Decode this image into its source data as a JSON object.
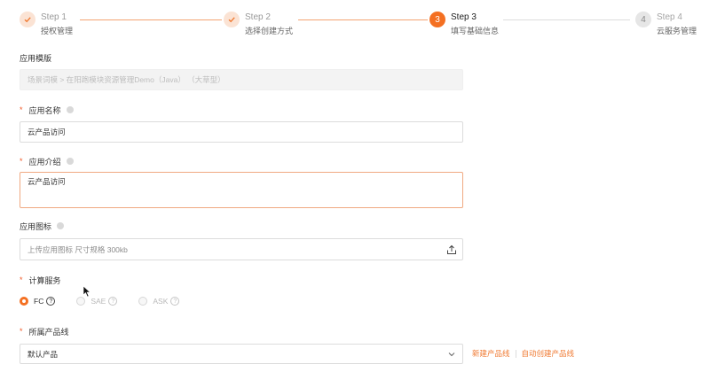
{
  "stepper": {
    "steps": [
      {
        "title": "Step 1",
        "desc": "授权管理",
        "status": "done",
        "icon": "check-icon"
      },
      {
        "title": "Step 2",
        "desc": "选择创建方式",
        "status": "done",
        "icon": "check-icon"
      },
      {
        "title": "Step 3",
        "desc": "填写基础信息",
        "status": "active",
        "number": "3"
      },
      {
        "title": "Step 4",
        "desc": "云服务管理",
        "status": "todo",
        "number": "4"
      }
    ]
  },
  "form": {
    "template": {
      "label": "应用模版",
      "value": "场景词模 > 在阳跑模块资源管理Demo（Java） （大草型）"
    },
    "app_name": {
      "label": "应用名称",
      "value": "云产品访问"
    },
    "app_desc": {
      "label": "应用介绍",
      "value": "云产品访问"
    },
    "app_icon": {
      "label": "应用图标",
      "placeholder": "上传应用图标 尺寸规格 300kb",
      "icon": "upload-icon"
    },
    "compute": {
      "label": "计算服务",
      "options": [
        {
          "label": "FC",
          "checked": true,
          "disabled": false
        },
        {
          "label": "SAE",
          "checked": false,
          "disabled": true
        },
        {
          "label": "ASK",
          "checked": false,
          "disabled": true
        }
      ],
      "help_glyph": "?"
    },
    "product_line": {
      "label": "所属产品线",
      "value": "默认产品",
      "links": [
        "新建产品线",
        "自动创建产品线"
      ]
    }
  },
  "colors": {
    "accent": "#f47022",
    "accent_light": "#fbe3d4",
    "required": "#f05a28"
  }
}
